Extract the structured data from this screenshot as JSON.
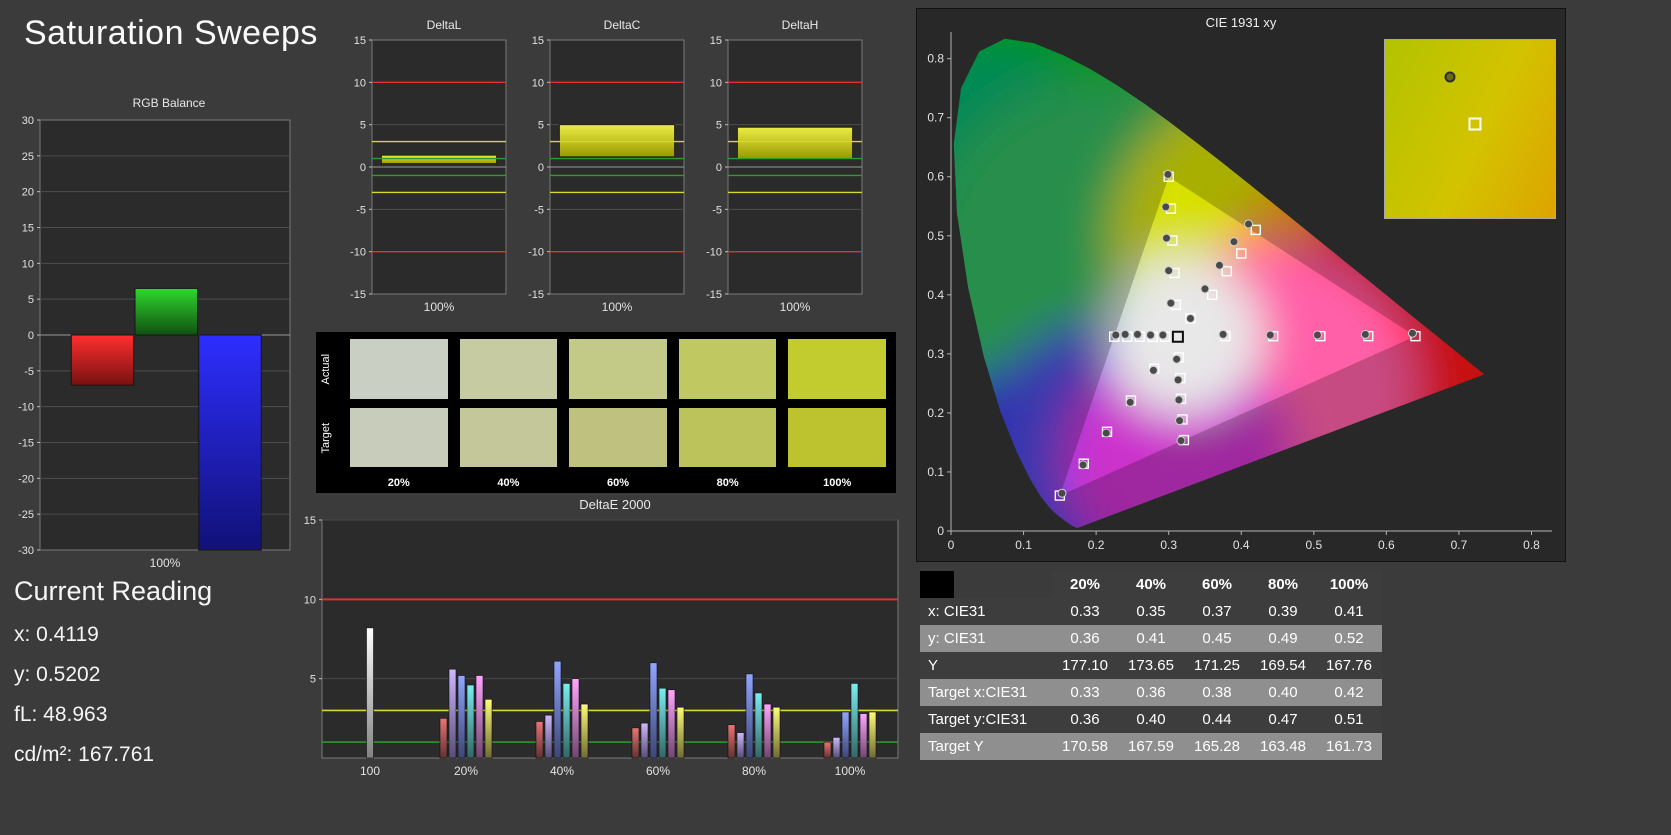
{
  "page": {
    "title": "Saturation Sweeps",
    "background": "#3b3b3b"
  },
  "current_reading": {
    "heading": "Current Reading",
    "lines": [
      "x: 0.4119",
      "y: 0.5202",
      "fL: 48.963",
      "cd/m²: 167.761"
    ]
  },
  "swatches": {
    "row_labels": [
      "Actual",
      "Target"
    ],
    "col_labels": [
      "20%",
      "40%",
      "60%",
      "80%",
      "100%"
    ],
    "actual_colors": [
      "#c9cfc2",
      "#c6cba1",
      "#c3c987",
      "#c0c961",
      "#c2cc2e"
    ],
    "target_colors": [
      "#c8ccbb",
      "#c4c79a",
      "#bfc27e",
      "#bcc35b",
      "#bcc32e"
    ]
  },
  "table": {
    "columns": [
      "",
      "20%",
      "40%",
      "60%",
      "80%",
      "100%"
    ],
    "rows": [
      {
        "label": "x: CIE31",
        "values": [
          "0.33",
          "0.35",
          "0.37",
          "0.39",
          "0.41"
        ]
      },
      {
        "label": "y: CIE31",
        "values": [
          "0.36",
          "0.41",
          "0.45",
          "0.49",
          "0.52"
        ]
      },
      {
        "label": "Y",
        "values": [
          "177.10",
          "173.65",
          "171.25",
          "169.54",
          "167.76"
        ]
      },
      {
        "label": "Target x:CIE31",
        "values": [
          "0.33",
          "0.36",
          "0.38",
          "0.40",
          "0.42"
        ]
      },
      {
        "label": "Target y:CIE31",
        "values": [
          "0.36",
          "0.40",
          "0.44",
          "0.47",
          "0.51"
        ]
      },
      {
        "label": "Target Y",
        "values": [
          "170.58",
          "167.59",
          "165.28",
          "163.48",
          "161.73"
        ]
      }
    ]
  },
  "chart_data": [
    {
      "id": "rgb_balance",
      "type": "bar",
      "title": "RGB Balance",
      "categories": [
        "100%"
      ],
      "ylim": [
        -30,
        30
      ],
      "ytick": 5,
      "series": [
        {
          "name": "red",
          "color": "#ee2222",
          "value": -7
        },
        {
          "name": "green",
          "color": "#22a022",
          "value": 6.5
        },
        {
          "name": "blue",
          "color": "#2222ee",
          "value": -30
        }
      ]
    },
    {
      "id": "deltaL",
      "type": "range-bar",
      "title": "DeltaL",
      "xlabel": "100%",
      "ylim": [
        -15,
        15
      ],
      "ytick": 5,
      "ref_lines": [
        {
          "y": 10,
          "color": "#e03030"
        },
        {
          "y": -10,
          "color": "#e03030"
        },
        {
          "y": 3,
          "color": "#d8d830"
        },
        {
          "y": -3,
          "color": "#d8d830"
        },
        {
          "y": 1,
          "color": "#2d9e2d"
        },
        {
          "y": -1,
          "color": "#2d9e2d"
        }
      ],
      "bar": {
        "min": 0.4,
        "max": 1.4,
        "color": "#d8d820"
      }
    },
    {
      "id": "deltaC",
      "type": "range-bar",
      "title": "DeltaC",
      "xlabel": "100%",
      "ylim": [
        -15,
        15
      ],
      "ytick": 5,
      "ref_lines": [
        {
          "y": 10,
          "color": "#e03030"
        },
        {
          "y": -10,
          "color": "#e03030"
        },
        {
          "y": 3,
          "color": "#d8d830"
        },
        {
          "y": -3,
          "color": "#d8d830"
        },
        {
          "y": 1,
          "color": "#2d9e2d"
        },
        {
          "y": -1,
          "color": "#2d9e2d"
        }
      ],
      "bar": {
        "min": 1.2,
        "max": 5.0,
        "color": "#d8d820"
      }
    },
    {
      "id": "deltaH",
      "type": "range-bar",
      "title": "DeltaH",
      "xlabel": "100%",
      "ylim": [
        -15,
        15
      ],
      "ytick": 5,
      "ref_lines": [
        {
          "y": 10,
          "color": "#e03030"
        },
        {
          "y": -10,
          "color": "#e03030"
        },
        {
          "y": 3,
          "color": "#d8d830"
        },
        {
          "y": -3,
          "color": "#d8d830"
        },
        {
          "y": 1,
          "color": "#2d9e2d"
        },
        {
          "y": -1,
          "color": "#2d9e2d"
        }
      ],
      "bar": {
        "min": 1.0,
        "max": 4.7,
        "color": "#d8d820"
      }
    },
    {
      "id": "deltaE2000",
      "type": "grouped-bar",
      "title": "DeltaE 2000",
      "ylim": [
        0,
        15
      ],
      "yticks": [
        5,
        10,
        15
      ],
      "ref_lines": [
        {
          "y": 10,
          "color": "#e03030",
          "w": 2
        },
        {
          "y": 3,
          "color": "#d8d830",
          "w": 1.6
        },
        {
          "y": 1,
          "color": "#2d9e2d",
          "w": 1.6
        }
      ],
      "bar_colors": [
        "#b35a5a",
        "#a08cd8",
        "#6f7fd4",
        "#5cb8b8",
        "#cc7fcc",
        "#c9c25c"
      ],
      "groups": [
        {
          "label": "100",
          "bars": [
            {
              "color": "#ececec",
              "value": 8.2
            }
          ]
        },
        {
          "label": "20%",
          "values": [
            2.5,
            5.6,
            5.2,
            4.6,
            5.2,
            3.7
          ]
        },
        {
          "label": "40%",
          "values": [
            2.3,
            2.7,
            6.1,
            4.7,
            5.0,
            3.4
          ]
        },
        {
          "label": "60%",
          "values": [
            1.9,
            2.2,
            6.0,
            4.4,
            4.3,
            3.2
          ]
        },
        {
          "label": "80%",
          "values": [
            2.1,
            1.6,
            5.3,
            4.1,
            3.4,
            3.2
          ]
        },
        {
          "label": "100%",
          "values": [
            1.0,
            1.3,
            2.9,
            4.7,
            2.8,
            2.9
          ]
        }
      ]
    },
    {
      "id": "cie",
      "type": "scatter",
      "title": "CIE 1931 xy",
      "xmax": 0.82,
      "ymax": 0.835,
      "ticks": [
        0,
        0.1,
        0.2,
        0.3,
        0.4,
        0.5,
        0.6,
        0.7,
        0.8
      ],
      "white_point": [
        0.3127,
        0.329
      ],
      "gamut_triangle": [
        [
          0.64,
          0.33
        ],
        [
          0.3,
          0.6
        ],
        [
          0.15,
          0.06
        ]
      ],
      "targets": [
        [
          0.378,
          0.33
        ],
        [
          0.444,
          0.33
        ],
        [
          0.509,
          0.33
        ],
        [
          0.575,
          0.33
        ],
        [
          0.64,
          0.33
        ],
        [
          0.31,
          0.383
        ],
        [
          0.308,
          0.437
        ],
        [
          0.305,
          0.492
        ],
        [
          0.303,
          0.546
        ],
        [
          0.3,
          0.6
        ],
        [
          0.28,
          0.275
        ],
        [
          0.248,
          0.221
        ],
        [
          0.215,
          0.168
        ],
        [
          0.183,
          0.114
        ],
        [
          0.15,
          0.06
        ],
        [
          0.295,
          0.329
        ],
        [
          0.278,
          0.329
        ],
        [
          0.26,
          0.329
        ],
        [
          0.243,
          0.329
        ],
        [
          0.225,
          0.329
        ],
        [
          0.314,
          0.294
        ],
        [
          0.316,
          0.259
        ],
        [
          0.317,
          0.224
        ],
        [
          0.319,
          0.189
        ],
        [
          0.321,
          0.154
        ],
        [
          0.33,
          0.36
        ],
        [
          0.36,
          0.4
        ],
        [
          0.38,
          0.44
        ],
        [
          0.4,
          0.47
        ],
        [
          0.42,
          0.51
        ]
      ],
      "measured": [
        [
          0.375,
          0.333
        ],
        [
          0.44,
          0.332
        ],
        [
          0.505,
          0.332
        ],
        [
          0.571,
          0.333
        ],
        [
          0.636,
          0.335
        ],
        [
          0.303,
          0.386
        ],
        [
          0.3,
          0.441
        ],
        [
          0.297,
          0.496
        ],
        [
          0.296,
          0.549
        ],
        [
          0.299,
          0.604
        ],
        [
          0.279,
          0.272
        ],
        [
          0.247,
          0.218
        ],
        [
          0.214,
          0.166
        ],
        [
          0.182,
          0.112
        ],
        [
          0.153,
          0.064
        ],
        [
          0.292,
          0.332
        ],
        [
          0.275,
          0.332
        ],
        [
          0.257,
          0.333
        ],
        [
          0.24,
          0.333
        ],
        [
          0.227,
          0.332
        ],
        [
          0.311,
          0.291
        ],
        [
          0.313,
          0.256
        ],
        [
          0.314,
          0.222
        ],
        [
          0.315,
          0.187
        ],
        [
          0.317,
          0.153
        ],
        [
          0.33,
          0.36
        ],
        [
          0.35,
          0.41
        ],
        [
          0.37,
          0.45
        ],
        [
          0.39,
          0.49
        ],
        [
          0.41,
          0.52
        ]
      ],
      "inset": {
        "measured_pos": [
          0.38,
          0.21
        ],
        "target_pos": [
          0.53,
          0.47
        ]
      }
    }
  ]
}
